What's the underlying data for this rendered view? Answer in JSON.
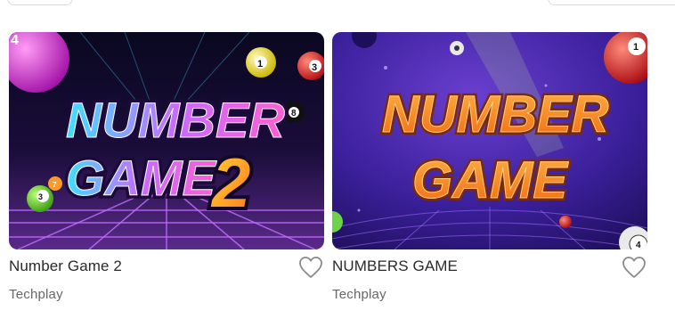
{
  "games": [
    {
      "title": "Number Game 2",
      "provider": "Techplay",
      "art": {
        "line1": "NUMBER",
        "line2": "GAME",
        "number": "2",
        "balls": [
          "3",
          "8",
          "1",
          "4",
          "7",
          "3"
        ]
      }
    },
    {
      "title": "NUMBERS GAME",
      "provider": "Techplay",
      "art": {
        "line1": "NUMBER",
        "line2": "GAME",
        "balls": [
          "1",
          "4"
        ]
      }
    }
  ],
  "icons": {
    "favorite": "heart-outline-icon"
  },
  "colors": {
    "title_text": "#2a2a2a",
    "provider_text": "#666666",
    "heart_stroke": "#8a8a8a"
  }
}
